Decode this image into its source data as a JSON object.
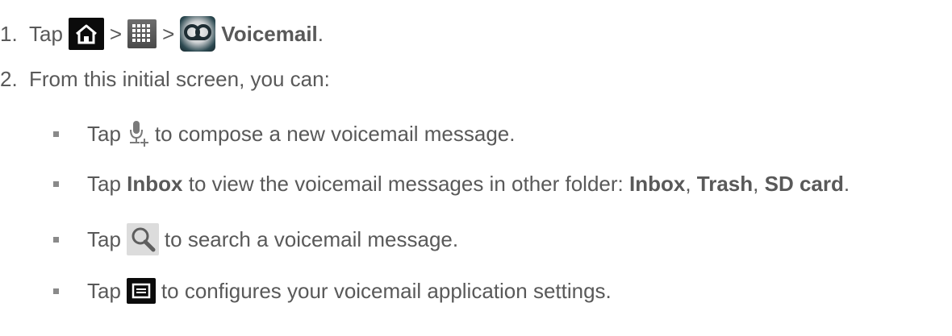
{
  "steps": [
    {
      "num": "1.",
      "tap": "Tap",
      "gt1": ">",
      "gt2": ">",
      "bold": "Voicemail",
      "end": "."
    },
    {
      "num": "2.",
      "text": "From this initial screen, you can:"
    }
  ],
  "bullets": [
    {
      "tap": "Tap",
      "rest": "to compose a new voicemail message."
    },
    {
      "tap": "Tap",
      "b1": "Inbox",
      "t1": " to view the voicemail messages in other folder: ",
      "b2": "Inbox",
      "t2": ", ",
      "b3": "Trash",
      "t3": ", ",
      "b4": "SD card",
      "t4": "."
    },
    {
      "tap": "Tap",
      "rest": "to search a voicemail message."
    },
    {
      "tap": "Tap",
      "rest": "to configures your voicemail application settings."
    }
  ],
  "icons": {
    "home": "home-icon",
    "apps": "apps-grid-icon",
    "voicemail": "voicemail-icon",
    "mic": "mic-plus-icon",
    "search": "search-icon",
    "menu": "menu-icon"
  }
}
